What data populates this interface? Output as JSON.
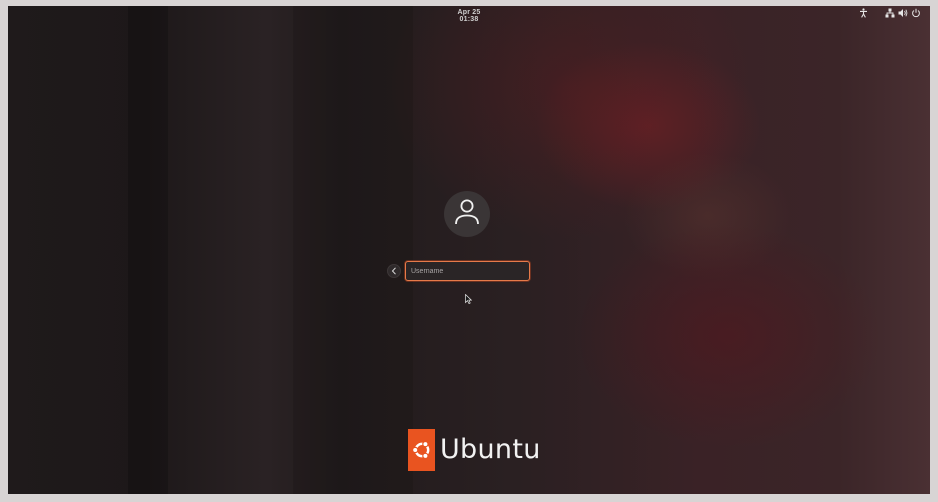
{
  "topbar": {
    "datetime": "Apr 25  01:38",
    "icons": [
      "accessibility-icon",
      "network-icon",
      "volume-icon",
      "power-icon"
    ]
  },
  "login": {
    "avatar_icon": "user-icon",
    "back_icon": "chevron-left-icon",
    "username_placeholder": "Username",
    "username_value": ""
  },
  "branding": {
    "logo_icon": "ubuntu-logo-icon",
    "name": "Ubuntu"
  },
  "colors": {
    "accent": "#e95420",
    "text": "#f2f2f2"
  }
}
